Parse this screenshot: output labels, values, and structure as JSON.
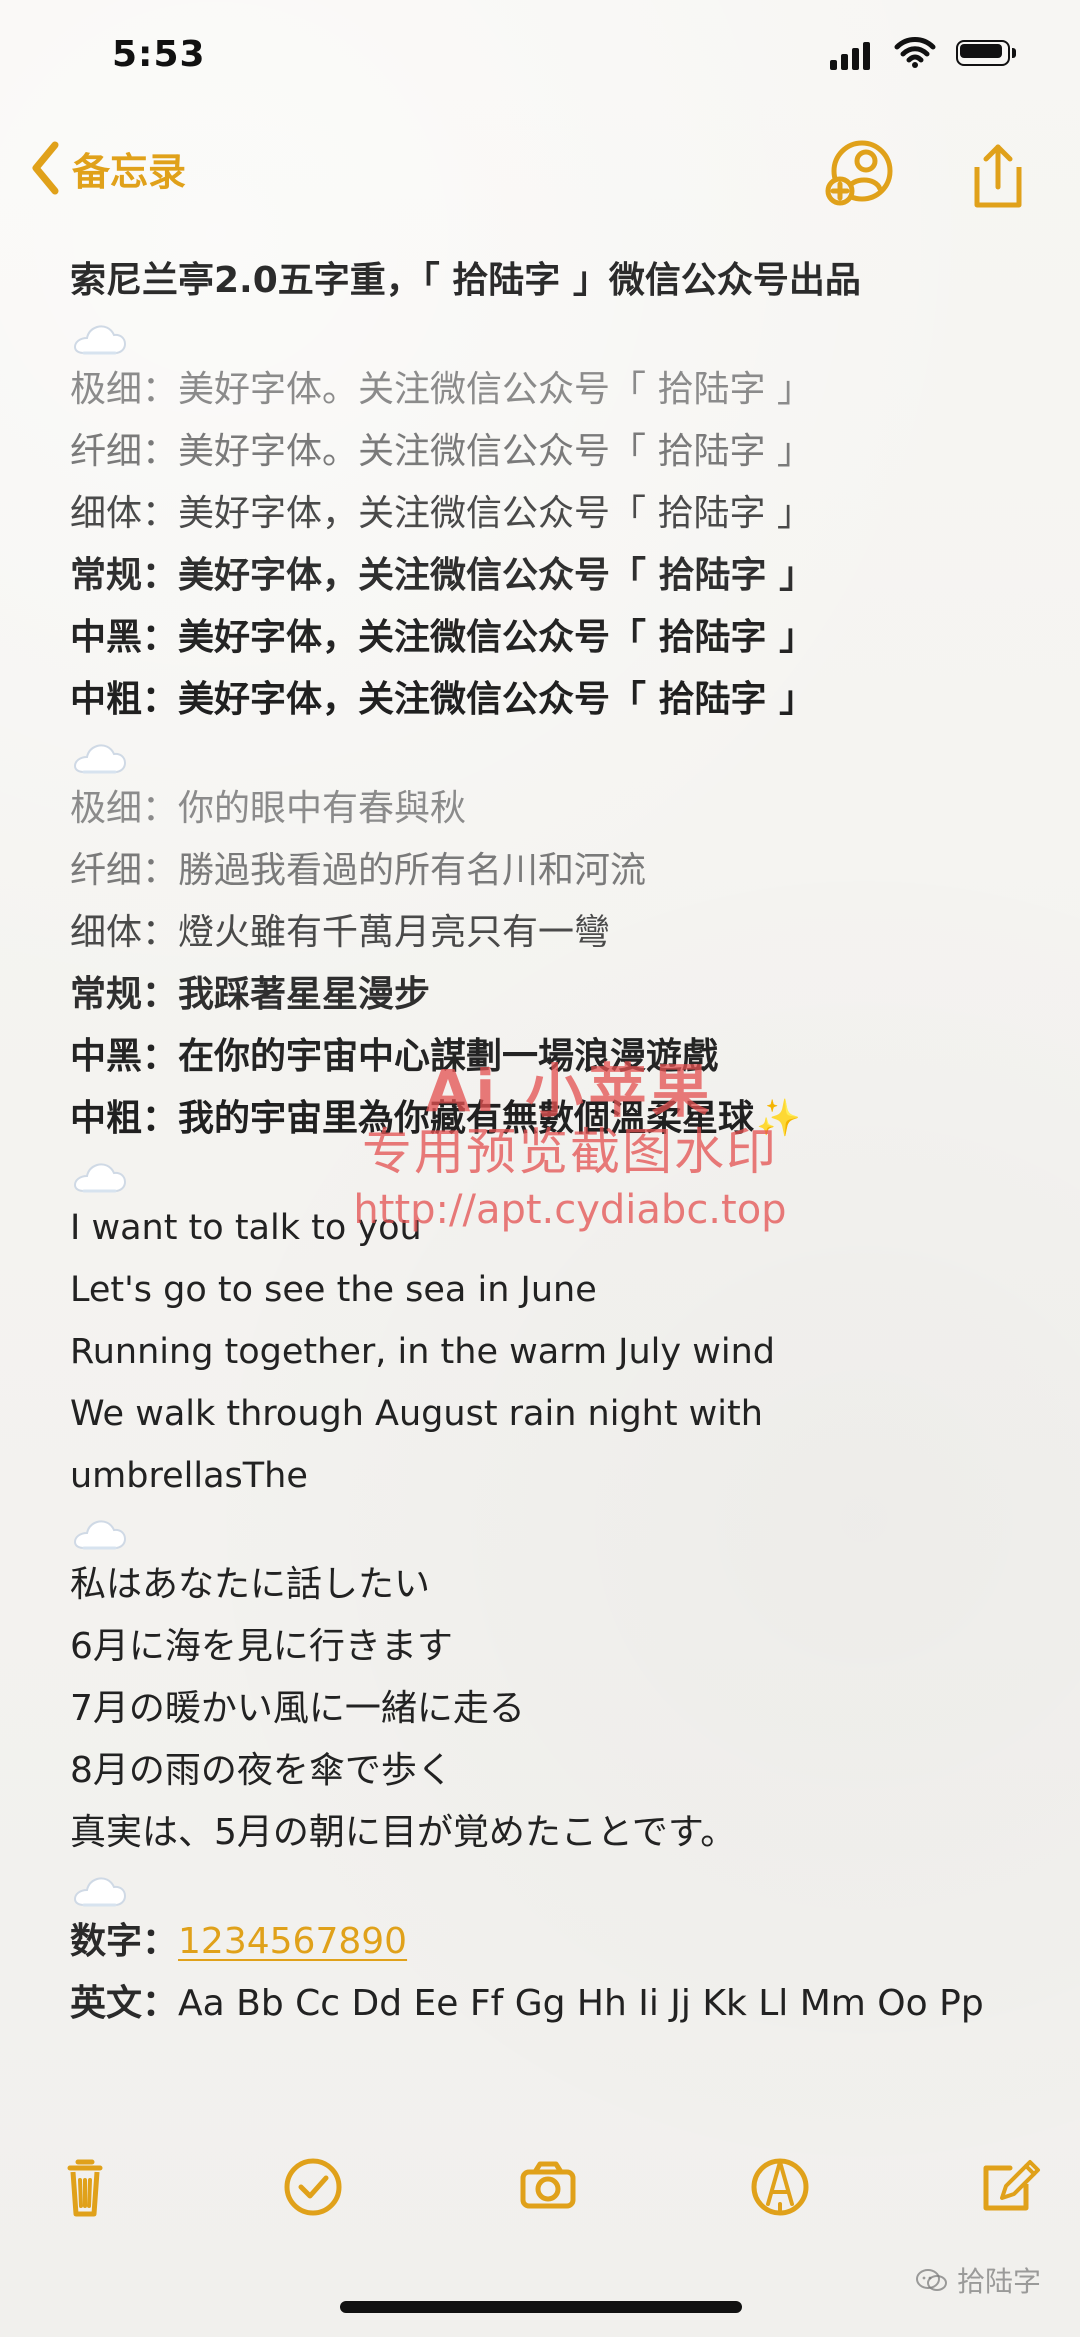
{
  "status": {
    "time": "5:53"
  },
  "nav": {
    "back_label": "备忘录"
  },
  "note": {
    "title": "索尼兰亭2.0五字重，「 拾陆字 」微信公众号出品",
    "cloud_icon": "cloud-icon",
    "section1": [
      "极细：美好字体。关注微信公众号「 拾陆字 」",
      "纤细：美好字体。关注微信公众号「 拾陆字 」",
      "细体：美好字体，关注微信公众号「 拾陆字 」",
      "常规：美好字体，关注微信公众号「 拾陆字 」",
      "中黑：美好字体，关注微信公众号「 拾陆字 」",
      "中粗：美好字体，关注微信公众号「 拾陆字 」"
    ],
    "section2": [
      "极细：你的眼中有春與秋",
      "纤细：勝過我看過的所有名川和河流",
      "细体：燈火雖有千萬月亮只有一彎",
      "常规：我踩著星星漫步",
      "中黑：在你的宇宙中心謀劃一場浪漫遊戲",
      "中粗：我的宇宙里為你藏有無數個溫柔星球"
    ],
    "sparkle": "✨",
    "section3": [
      "I want to talk to you",
      "Let's go to see the sea in June",
      "Running together, in the warm July wind",
      "We walk through August rain night with",
      "umbrellasThe"
    ],
    "section4": [
      "私はあなたに話したい",
      "6月に海を見に行きます",
      "7月の暖かい風に一緒に走る",
      "8月の雨の夜を傘で歩く",
      "真実は、5月の朝に目が覚めたことです。"
    ],
    "numbers_label": "数字：",
    "numbers_value": "1234567890",
    "english_label": "英文：",
    "english_value": "Aa Bb Cc Dd Ee Ff Gg Hh Ii Jj Kk Ll Mm Oo Pp"
  },
  "watermark": {
    "line1": "Ai 小苹果",
    "line2": "专用预览截图水印",
    "line3": "http://apt.cydiabc.top"
  },
  "footer": {
    "brand": "拾陆字"
  },
  "colors": {
    "accent": "#e0a11a",
    "watermark": "#e35252"
  }
}
